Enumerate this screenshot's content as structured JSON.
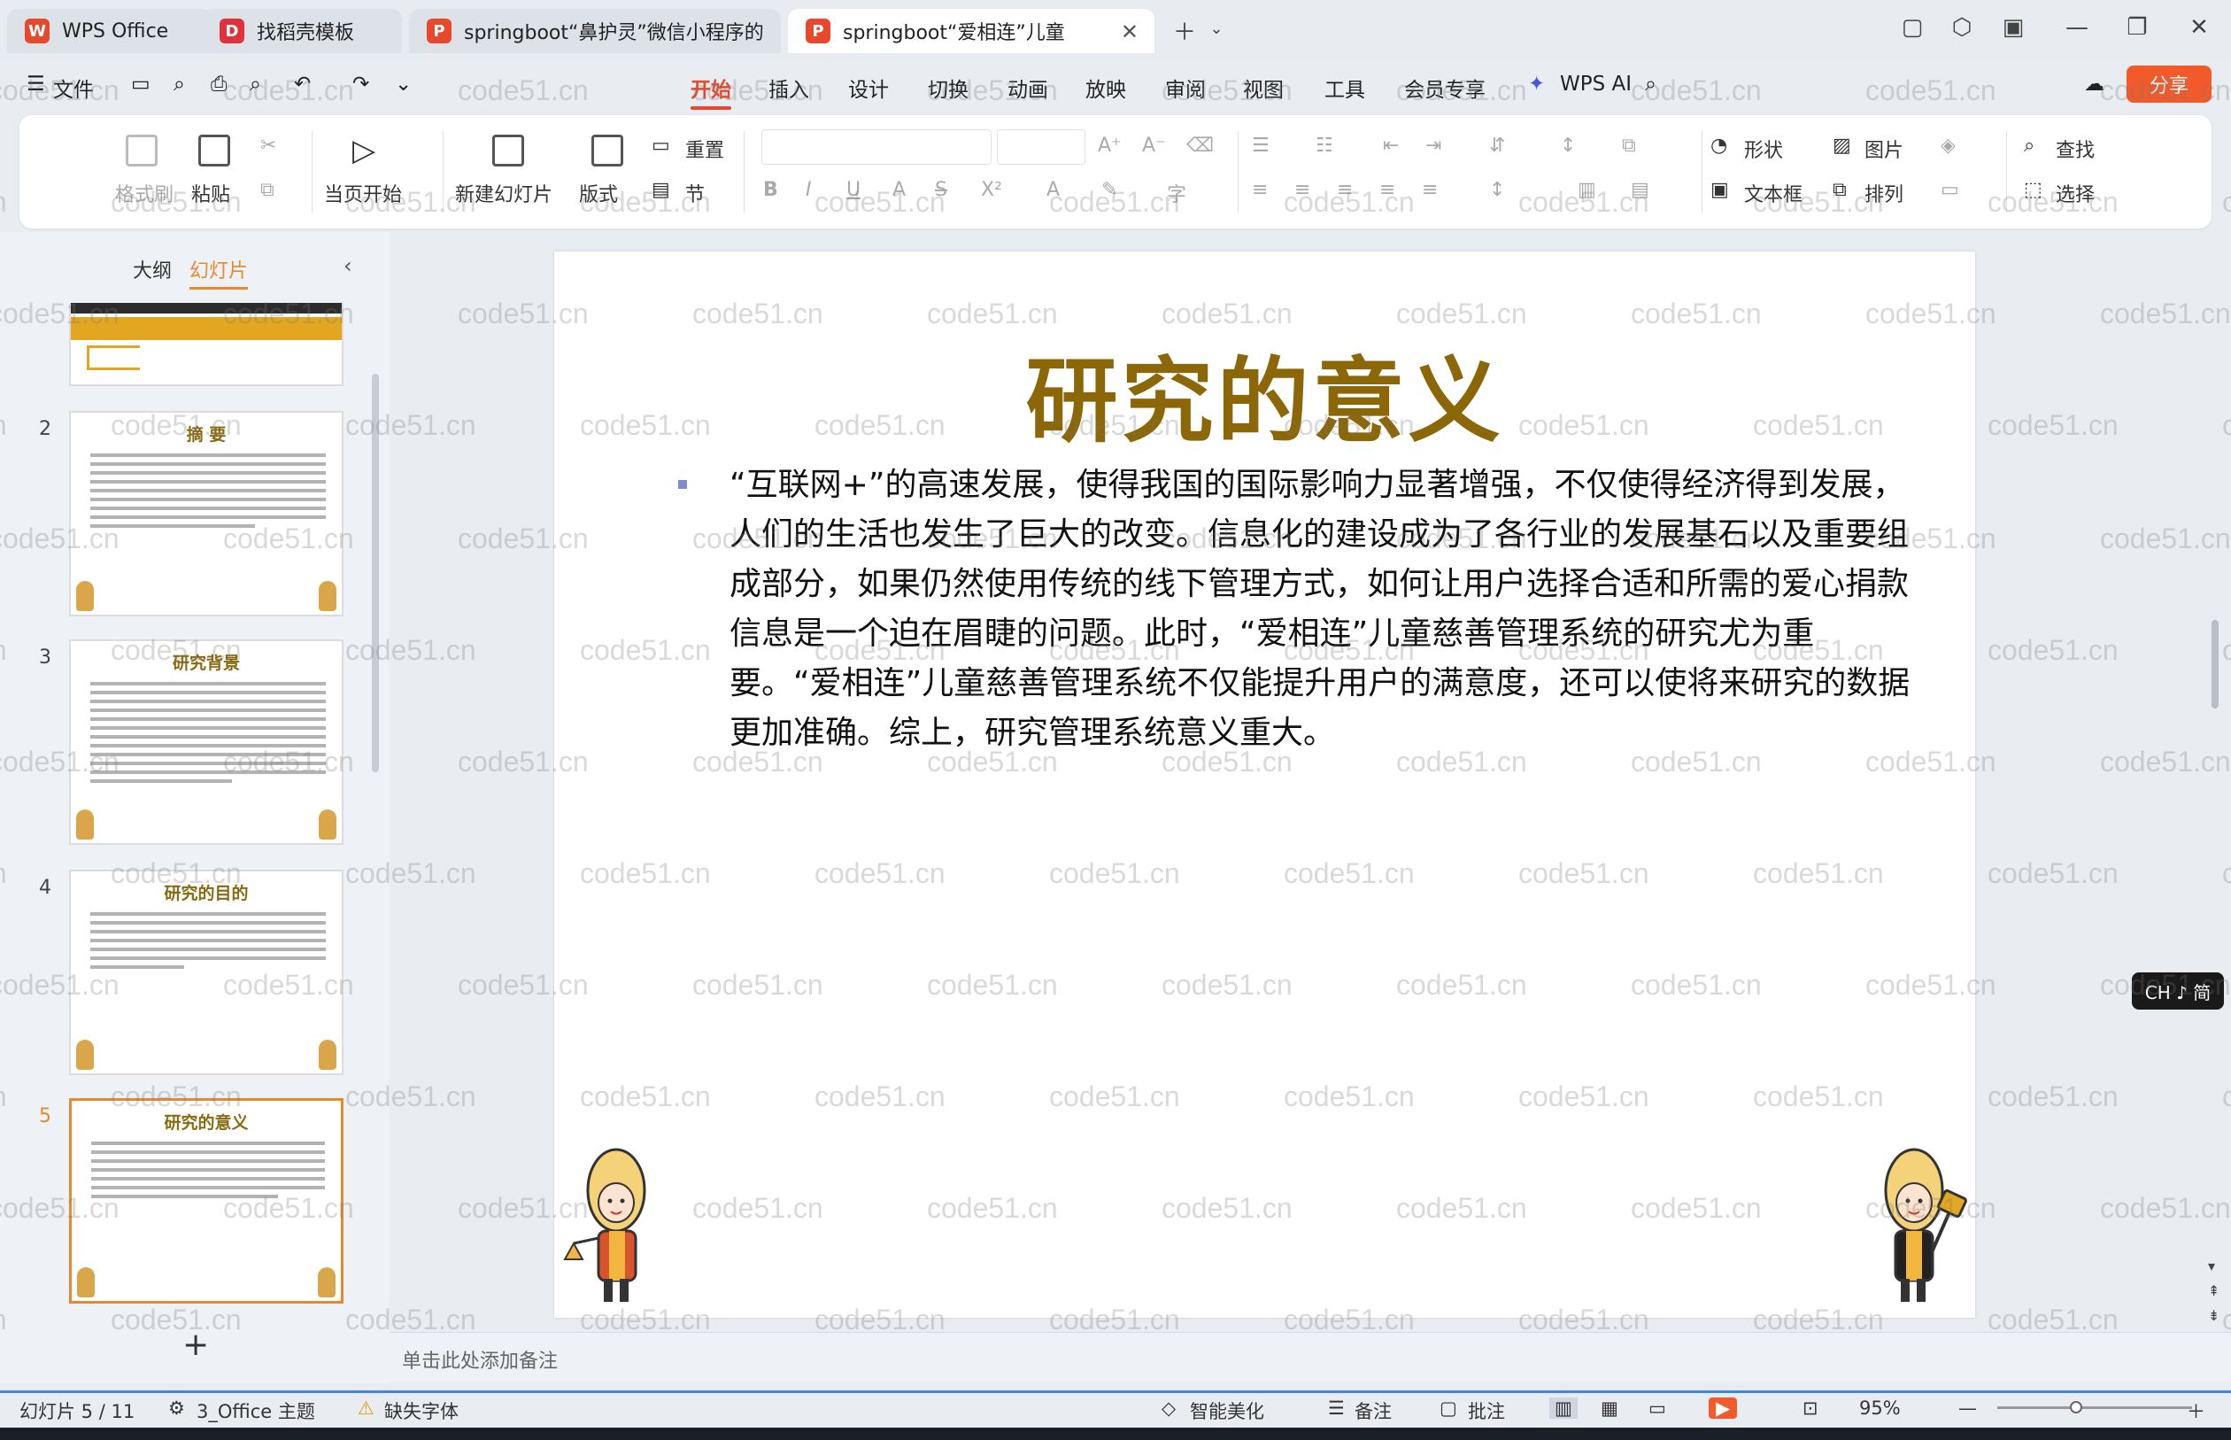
{
  "tabs": [
    {
      "label": "WPS Office"
    },
    {
      "label": "找稻壳模板"
    },
    {
      "label": "springboot“鼻护灵”微信小程序的"
    },
    {
      "label": "springboot“爱相连”儿童"
    }
  ],
  "menu": {
    "file": "文件",
    "items": [
      "开始",
      "插入",
      "设计",
      "切换",
      "动画",
      "放映",
      "审阅",
      "视图",
      "工具",
      "会员专享"
    ],
    "active": "开始",
    "wps_ai": "WPS AI",
    "share": "分享"
  },
  "ribbon": {
    "format_painter": "格式刷",
    "paste": "粘贴",
    "from_current": "当页开始",
    "new_slide": "新建幻灯片",
    "layout": "版式",
    "section": "节",
    "reset": "重置",
    "shape": "形状",
    "picture": "图片",
    "find": "查找",
    "textbox": "文本框",
    "arrange": "排列",
    "select": "选择"
  },
  "left_panel": {
    "tab_outline": "大纲",
    "tab_slides": "幻灯片",
    "thumbs": [
      {
        "num": "2",
        "title": "摘 要"
      },
      {
        "num": "3",
        "title": "研究背景"
      },
      {
        "num": "4",
        "title": "研究的目的"
      },
      {
        "num": "5",
        "title": "研究的意义"
      }
    ],
    "add": "+"
  },
  "slide": {
    "title": "研究的意义",
    "body": "“互联网+”的高速发展，使得我国的国际影响力显著增强，不仅使得经济得到发展，人们的生活也发生了巨大的改变。信息化的建设成为了各行业的发展基石以及重要组成部分，如果仍然使用传统的线下管理方式，如何让用户选择合适和所需的爱心捐款信息是一个迫在眉睫的问题。此时，“爱相连”儿童慈善管理系统的研究尤为重要。“爱相连”儿童慈善管理系统不仅能提升用户的满意度，还可以使将来研究的数据更加准确。综上，研究管理系统意义重大。"
  },
  "notes_placeholder": "单击此处添加备注",
  "status": {
    "slide_count": "幻灯片 5 / 11",
    "theme": "3_Office 主题",
    "missing_font": "缺失字体",
    "beautify": "智能美化",
    "notes": "备注",
    "comment": "批注",
    "zoom": "95%"
  },
  "ime": "CH ♪ 简",
  "watermark": "code51.cn",
  "colors": {
    "accent": "#e8492d",
    "title_gold": "#8b6708",
    "share": "#f25a2b"
  }
}
